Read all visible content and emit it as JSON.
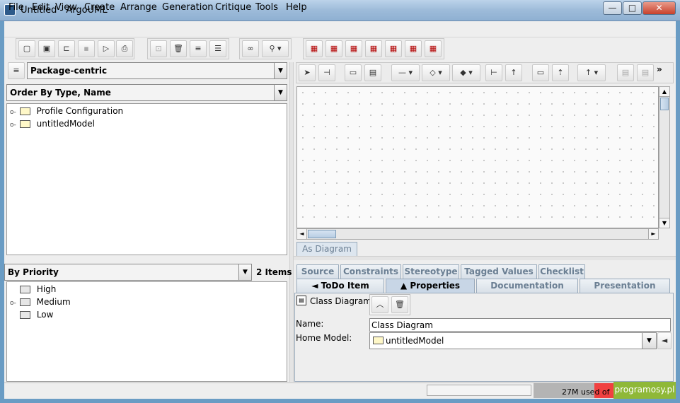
{
  "window": {
    "title": "Untitled - ArgoUML",
    "minimize": "—",
    "maximize": "□",
    "close": "✕"
  },
  "menu": {
    "items": [
      {
        "label": "File"
      },
      {
        "label": "Edit"
      },
      {
        "label": "View"
      },
      {
        "label": "Create"
      },
      {
        "label": "Arrange"
      },
      {
        "label": "Generation"
      },
      {
        "label": "Critique"
      },
      {
        "label": "Tools"
      },
      {
        "label": "Help"
      }
    ]
  },
  "toolbar": {
    "icons": [
      "new-diagram-icon",
      "new-project-icon",
      "open-icon",
      "save-icon",
      "save-as-icon",
      "print-icon",
      "navigate-icon",
      "delete-icon",
      "align-icon",
      "distribute-icon",
      "find-icon",
      "zoom-icon",
      "class-diagram-icon",
      "usecase-diagram-icon",
      "sequence-diagram-icon",
      "collaboration-diagram-icon",
      "statechart-diagram-icon",
      "activity-diagram-icon",
      "deployment-diagram-icon"
    ]
  },
  "explorer": {
    "perspective": "Package-centric",
    "order": "Order By Type, Name",
    "tree": [
      {
        "label": "Profile Configuration"
      },
      {
        "label": "untitledModel"
      }
    ]
  },
  "diagram": {
    "tab_label": "As Diagram",
    "palette_overflow": "»"
  },
  "todo": {
    "sort": "By Priority",
    "count": "2 Items",
    "groups": [
      {
        "label": "High"
      },
      {
        "label": "Medium"
      },
      {
        "label": "Low"
      }
    ]
  },
  "details": {
    "top_tabs": [
      {
        "label": "Source"
      },
      {
        "label": "Constraints"
      },
      {
        "label": "Stereotype"
      },
      {
        "label": "Tagged Values"
      },
      {
        "label": "Checklist"
      }
    ],
    "bottom_tabs": [
      {
        "label": "◄ ToDo Item"
      },
      {
        "label": "▲ Properties"
      },
      {
        "label": "Documentation"
      },
      {
        "label": "Presentation"
      }
    ],
    "element_type": "Class Diagram",
    "name_label": "Name:",
    "name_value": "Class Diagram",
    "home_model_label": "Home Model:",
    "home_model_value": "untitledModel"
  },
  "status": {
    "memory": "27M used of",
    "watermark": "programosy.pl"
  },
  "colors": {
    "accent": "#c8d6e6",
    "memory_bar": "#f04040",
    "watermark_bg": "#8fb838"
  }
}
